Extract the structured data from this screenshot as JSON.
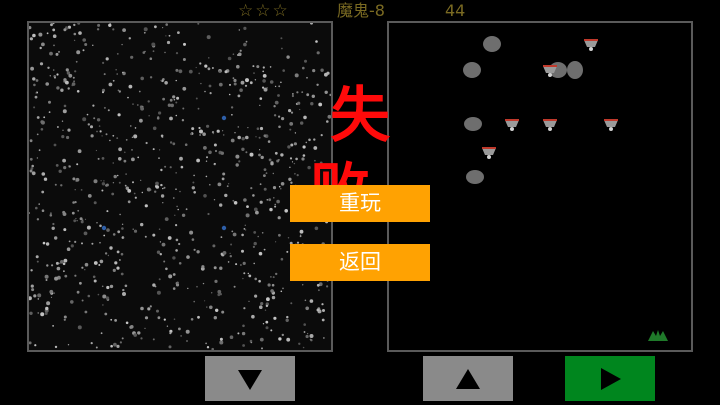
{
  "hud": {
    "stars": "☆☆☆",
    "stars_filled": 0,
    "stars_total": 3,
    "level": "魔鬼-8",
    "score": "44"
  },
  "dialog": {
    "title": "失 败",
    "replay_label": "重玩",
    "back_label": "返回"
  },
  "controls": {
    "down_icon": "triangle-down-icon",
    "up_icon": "triangle-up-icon",
    "play_icon": "play-icon"
  },
  "colors": {
    "fail_text": "#ff0a0a",
    "menu_button": "#ffa202",
    "control_button": "#8a8a8a",
    "play_button": "#00861e",
    "hud_text": "#7a6a22",
    "panel_border": "#5a5a5a"
  }
}
